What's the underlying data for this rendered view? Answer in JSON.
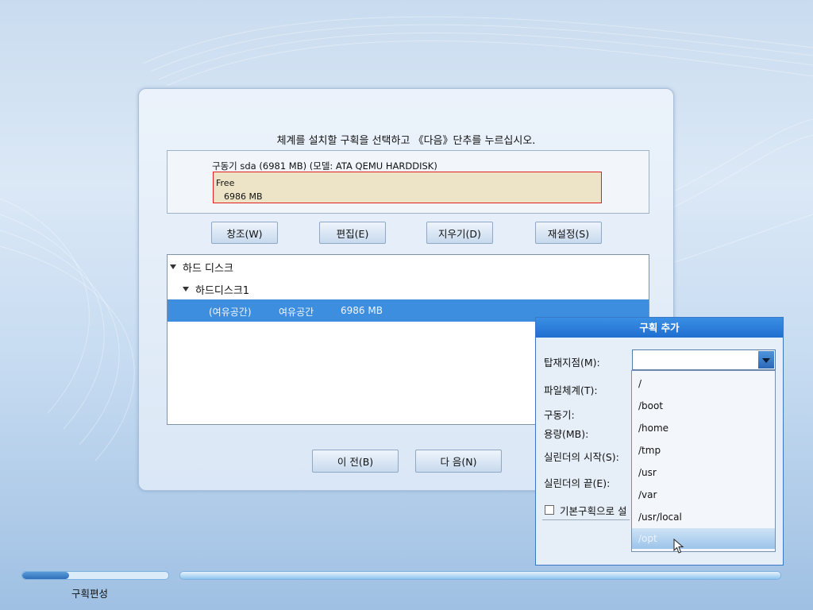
{
  "main": {
    "instruction": "체계를 설치할 구획을 선택하고 《다음》단추를 누르십시오.",
    "drive_label": "구동기 sda (6981 MB) (모델: ATA QEMU HARDDISK)",
    "free_label": "Free",
    "free_size": "6986 MB",
    "buttons": {
      "create": "창조(W)",
      "edit": "편집(E)",
      "delete": "지우기(D)",
      "reset": "재설정(S)"
    },
    "tree": {
      "root": "하드 디스크",
      "disk": "하드디스크1",
      "row": {
        "col1": "(여유공간)",
        "col2": "여유공간",
        "col3": "6986 MB"
      }
    },
    "nav": {
      "back": "이 전(B)",
      "next": "다 음(N)"
    }
  },
  "progress": {
    "fraction": 0.32,
    "step_label": "구획편성"
  },
  "dialog": {
    "title": "구획 추가",
    "labels": {
      "mount": "탑재지점(M):",
      "fs": "파일체계(T):",
      "drive": "구동기:",
      "size": "용량(MB):",
      "cyl_start": "실린더의 시작(S):",
      "cyl_end": "실린더의 끝(E):",
      "primary": "기본구획으로 설"
    },
    "mount_value": "",
    "mount_options": [
      "/",
      "/boot",
      "/home",
      "/tmp",
      "/usr",
      "/var",
      "/usr/local",
      "/opt"
    ],
    "highlighted_option": "/opt"
  },
  "colors": {
    "selection": "#3d8ede",
    "dialog_title": "#1f6fd0",
    "free_border": "#e01f1f",
    "free_fill": "#ede4c8"
  }
}
